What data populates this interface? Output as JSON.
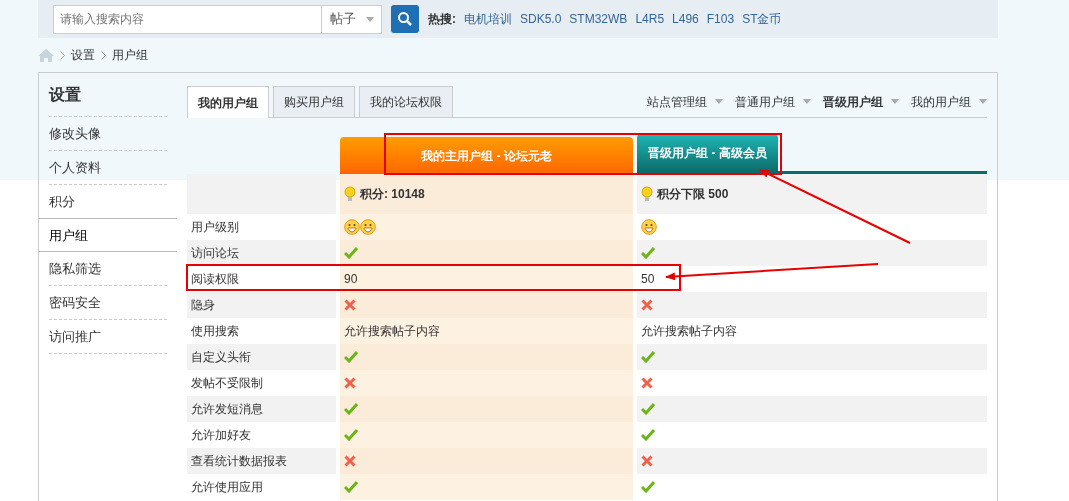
{
  "search": {
    "placeholder": "请输入搜索内容",
    "scope": "帖子"
  },
  "hot": {
    "label": "热搜:",
    "links": [
      "电机培训",
      "SDK5.0",
      "STM32WB",
      "L4R5",
      "L496",
      "F103",
      "ST金币"
    ]
  },
  "breadcrumb": [
    "设置",
    "用户组"
  ],
  "sidebar": {
    "title": "设置",
    "items": [
      {
        "label": "修改头像",
        "selected": false
      },
      {
        "label": "个人资料",
        "selected": false
      },
      {
        "label": "积分",
        "selected": false
      },
      {
        "label": "用户组",
        "selected": true
      },
      {
        "label": "隐私筛选",
        "selected": false
      },
      {
        "label": "密码安全",
        "selected": false
      },
      {
        "label": "访问推广",
        "selected": false
      }
    ]
  },
  "tabs": [
    {
      "label": "我的用户组",
      "selected": true
    },
    {
      "label": "购买用户组",
      "selected": false
    },
    {
      "label": "我的论坛权限",
      "selected": false
    }
  ],
  "group_links": [
    {
      "label": "站点管理组",
      "selected": false
    },
    {
      "label": "普通用户组",
      "selected": false
    },
    {
      "label": "晋级用户组",
      "selected": true
    },
    {
      "label": "我的用户组",
      "selected": false
    }
  ],
  "columns": [
    {
      "title": "我的主用户组 - 论坛元老",
      "kind": "current",
      "points": "积分: 10148"
    },
    {
      "title": "晋级用户组 - 高级会员",
      "kind": "next",
      "points": "积分下限 500"
    }
  ],
  "rows": [
    {
      "label": "用户级别",
      "values": [
        {
          "kind": "icons",
          "icons": [
            {
              "kind": "smiley"
            },
            {
              "kind": "smiley"
            }
          ]
        },
        {
          "kind": "icons",
          "icons": [
            {
              "kind": "smiley"
            }
          ]
        }
      ]
    },
    {
      "label": "访问论坛",
      "values": [
        {
          "kind": "check",
          "allowed": true
        },
        {
          "kind": "check",
          "allowed": true
        }
      ]
    },
    {
      "label": "阅读权限",
      "values": [
        {
          "kind": "text",
          "text": "90"
        },
        {
          "kind": "text",
          "text": "50"
        }
      ]
    },
    {
      "label": "隐身",
      "values": [
        {
          "kind": "check",
          "allowed": false
        },
        {
          "kind": "check",
          "allowed": false
        }
      ]
    },
    {
      "label": "使用搜索",
      "values": [
        {
          "kind": "text",
          "text": "允许搜索帖子内容"
        },
        {
          "kind": "text",
          "text": "允许搜索帖子内容"
        }
      ]
    },
    {
      "label": "自定义头衔",
      "values": [
        {
          "kind": "check",
          "allowed": true
        },
        {
          "kind": "check",
          "allowed": true
        }
      ]
    },
    {
      "label": "发帖不受限制",
      "values": [
        {
          "kind": "check",
          "allowed": false
        },
        {
          "kind": "check",
          "allowed": false
        }
      ]
    },
    {
      "label": "允许发短消息",
      "values": [
        {
          "kind": "check",
          "allowed": true
        },
        {
          "kind": "check",
          "allowed": true
        }
      ]
    },
    {
      "label": "允许加好友",
      "values": [
        {
          "kind": "check",
          "allowed": true
        },
        {
          "kind": "check",
          "allowed": true
        }
      ]
    },
    {
      "label": "查看统计数据报表",
      "values": [
        {
          "kind": "check",
          "allowed": false
        },
        {
          "kind": "check",
          "allowed": false
        }
      ]
    },
    {
      "label": "允许使用应用",
      "values": [
        {
          "kind": "check",
          "allowed": true
        },
        {
          "kind": "check",
          "allowed": true
        }
      ]
    }
  ]
}
